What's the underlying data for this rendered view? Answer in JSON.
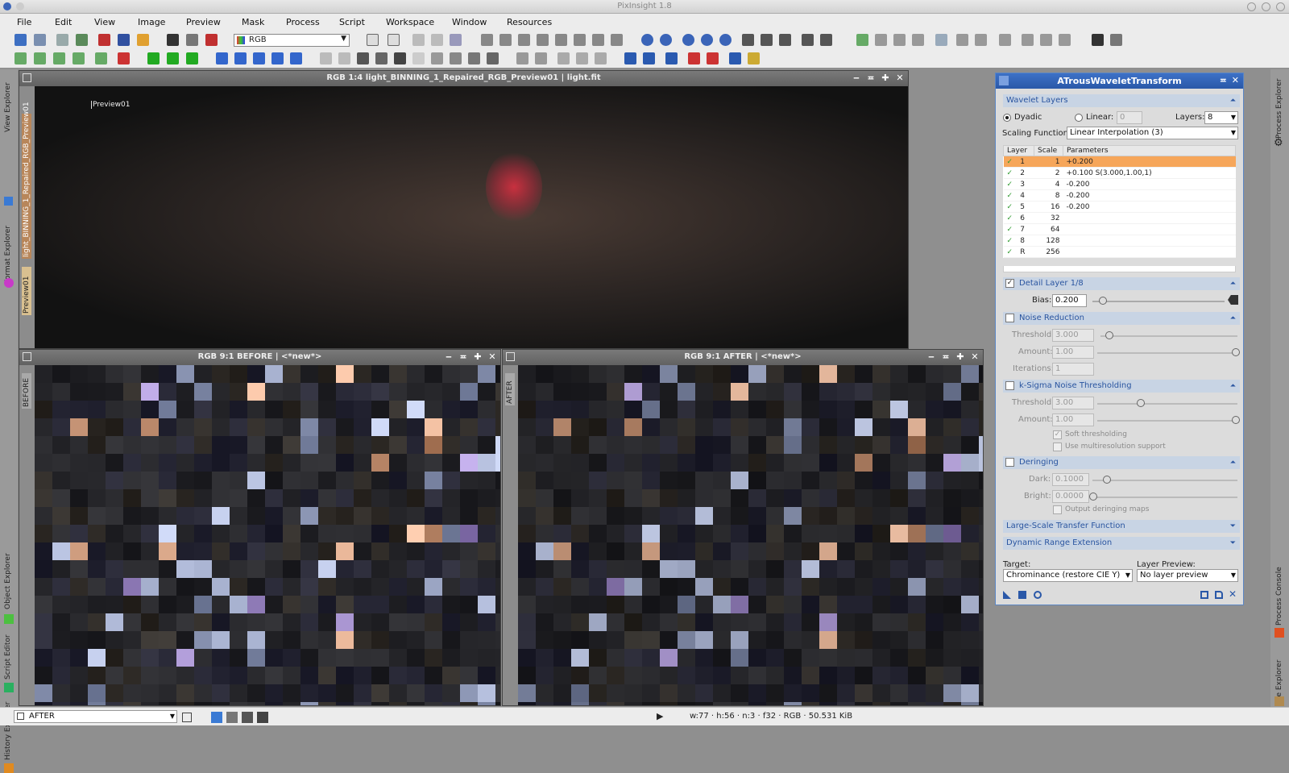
{
  "app": {
    "title": "PixInsight 1.8"
  },
  "menu": [
    "File",
    "Edit",
    "View",
    "Image",
    "Preview",
    "Mask",
    "Process",
    "Script",
    "Workspace",
    "Window",
    "Resources"
  ],
  "toolbar": {
    "color_mode": "RGB"
  },
  "left_dock": {
    "tabs": [
      "View Explorer",
      "Format Explorer",
      "Object Explorer",
      "Script Editor",
      "History Explorer"
    ]
  },
  "right_dock": {
    "tabs": [
      "Process Explorer",
      "Process Console",
      "File Explorer"
    ]
  },
  "main_window": {
    "title": "RGB 1:4 light_BINNING_1_Repaired_RGB_Preview01 | light.fit",
    "tabs": [
      "light_BINNING_1_Repaired_RGB_Preview01",
      "Preview01"
    ],
    "preview_label": "Preview01"
  },
  "before_window": {
    "title": "RGB 9:1 BEFORE | <*new*>",
    "tab": "BEFORE"
  },
  "after_window": {
    "title": "RGB 9:1 AFTER | <*new*>",
    "tab": "AFTER"
  },
  "atwt": {
    "title": "ATrousWaveletTransform",
    "wavelet_layers": {
      "header": "Wavelet Layers",
      "dyadic_label": "Dyadic",
      "linear_label": "Linear:",
      "linear_value": "0",
      "layers_label": "Layers:",
      "layers_value": "8",
      "scaling_label": "Scaling Function:",
      "scaling_value": "Linear Interpolation (3)",
      "columns": [
        "Layer",
        "Scale",
        "Parameters"
      ],
      "rows": [
        {
          "layer": "1",
          "scale": "1",
          "params": "+0.200"
        },
        {
          "layer": "2",
          "scale": "2",
          "params": "+0.100 S(3.000,1.00,1)"
        },
        {
          "layer": "3",
          "scale": "4",
          "params": "-0.200"
        },
        {
          "layer": "4",
          "scale": "8",
          "params": "-0.200"
        },
        {
          "layer": "5",
          "scale": "16",
          "params": "-0.200"
        },
        {
          "layer": "6",
          "scale": "32",
          "params": ""
        },
        {
          "layer": "7",
          "scale": "64",
          "params": ""
        },
        {
          "layer": "8",
          "scale": "128",
          "params": ""
        },
        {
          "layer": "R",
          "scale": "256",
          "params": ""
        }
      ]
    },
    "detail_layer": {
      "header": "Detail Layer 1/8",
      "bias_label": "Bias:",
      "bias_value": "0.200"
    },
    "noise_reduction": {
      "header": "Noise Reduction",
      "threshold_label": "Threshold:",
      "threshold_value": "3.000",
      "amount_label": "Amount:",
      "amount_value": "1.00",
      "iterations_label": "Iterations:",
      "iterations_value": "1"
    },
    "ksigma": {
      "header": "k-Sigma Noise Thresholding",
      "threshold_label": "Threshold:",
      "threshold_value": "3.00",
      "amount_label": "Amount:",
      "amount_value": "1.00",
      "soft_label": "Soft thresholding",
      "multires_label": "Use multiresolution support"
    },
    "deringing": {
      "header": "Deringing",
      "dark_label": "Dark:",
      "dark_value": "0.1000",
      "bright_label": "Bright:",
      "bright_value": "0.0000",
      "output_label": "Output deringing maps"
    },
    "large_scale": {
      "header": "Large-Scale Transfer Function"
    },
    "dynamic_range": {
      "header": "Dynamic Range Extension"
    },
    "target_label": "Target:",
    "target_value": "Chrominance (restore CIE Y)",
    "layer_preview_label": "Layer Preview:",
    "layer_preview_value": "No layer preview"
  },
  "status": {
    "view": "AFTER",
    "info": "w:77 · h:56 · n:3 · f32 · RGB · 50.531 KiB"
  },
  "colors": {
    "accent": "#2a58a8",
    "selection": "#f6a65a",
    "nebula": "#c8303f"
  }
}
